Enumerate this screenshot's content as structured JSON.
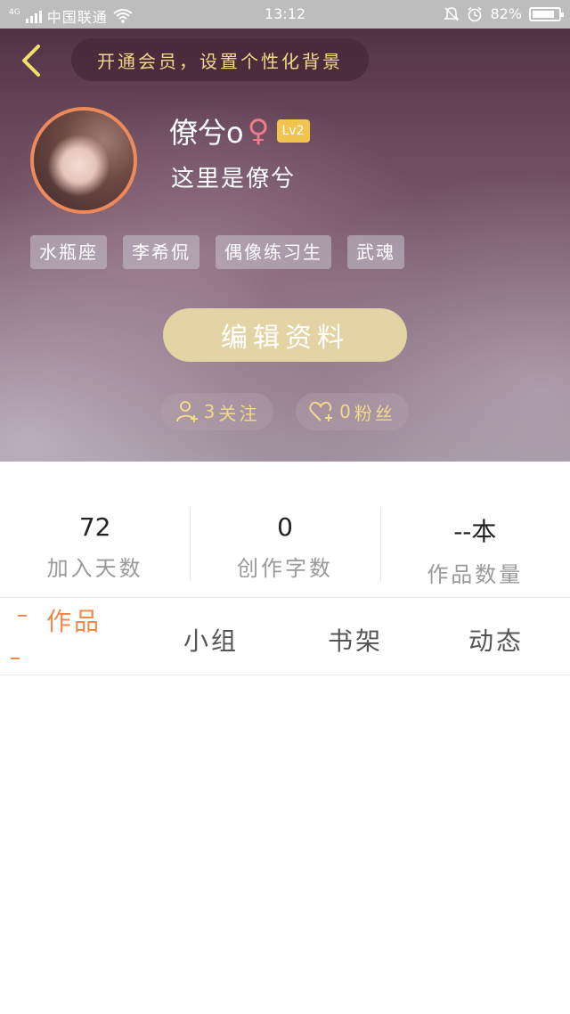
{
  "status_bar": {
    "network": "4G",
    "carrier": "中国联通",
    "time": "13:12",
    "battery": "82%"
  },
  "header": {
    "back_icon": "chevron-left-icon",
    "vip_banner": "开通会员，设置个性化背景"
  },
  "profile": {
    "nickname": "僚兮o",
    "gender_symbol": "♀",
    "level": "Lv2",
    "bio": "这里是僚兮",
    "tags": [
      "水瓶座",
      "李希侃",
      "偶像练习生",
      "武魂"
    ],
    "edit_button": "编辑资料",
    "follow": {
      "count": "3",
      "label": "关注",
      "icon": "add-user-icon"
    },
    "fans": {
      "count": "0",
      "label": "粉丝",
      "icon": "heart-add-icon"
    }
  },
  "stats": [
    {
      "value": "72",
      "label": "加入天数"
    },
    {
      "value": "0",
      "label": "创作字数"
    },
    {
      "value": "--本",
      "label": "作品数量"
    }
  ],
  "tabs": [
    {
      "label": "作品",
      "active": true
    },
    {
      "label": "小组",
      "active": false
    },
    {
      "label": "书架",
      "active": false
    },
    {
      "label": "动态",
      "active": false
    }
  ],
  "colors": {
    "accent": "#ef8a4c",
    "gold": "#f3d98a",
    "badge": "#f2c34e",
    "edit_button": "#e3d3a5",
    "avatar_border": "#ee8a5a"
  }
}
